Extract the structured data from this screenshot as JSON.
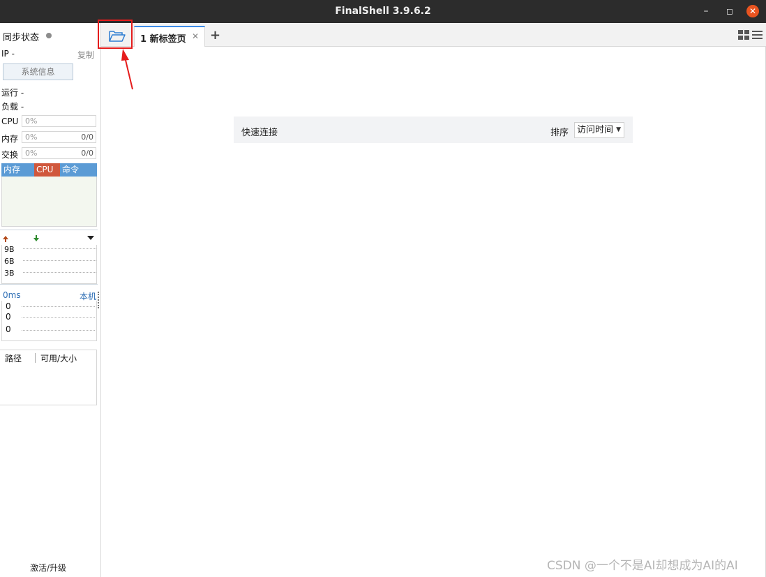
{
  "window": {
    "title": "FinalShell 3.9.6.2",
    "controls": [
      "minimize",
      "maximize",
      "close"
    ]
  },
  "sidebar": {
    "sync_status": "同步状态",
    "ip_label": "IP  -",
    "copy": "复制",
    "sysinfo_button": "系统信息",
    "running": "运行 -",
    "load": "负载 -",
    "cpu_label": "CPU",
    "cpu_value": "0%",
    "mem_label": "内存",
    "mem_value": "0%",
    "mem_ratio": "0/0",
    "swap_label": "交换",
    "swap_value": "0%",
    "swap_ratio": "0/0",
    "process_columns": [
      "内存",
      "CPU",
      "命令"
    ],
    "net_scale": [
      "9B",
      "6B",
      "3B"
    ],
    "ping_ms": "0ms",
    "ping_host": "本机",
    "ping_values": [
      "0",
      "0",
      "0"
    ],
    "disk_columns": [
      "路径",
      "可用/大小"
    ],
    "activate": "激活/升级"
  },
  "tabs": {
    "items": [
      {
        "label": "1 新标签页",
        "active": true
      }
    ],
    "add_label": "+"
  },
  "main": {
    "quick_connect": "快速连接",
    "sort_label": "排序",
    "sort_value": "访问时间"
  },
  "watermark": "CSDN @一个不是AI却想成为AI的AI",
  "colors": {
    "accent": "#3c8ce7",
    "process_header": "#5b9bd5",
    "cpu_column": "#d0573c",
    "annotation": "#e51c1c",
    "close_button": "#e95420"
  }
}
